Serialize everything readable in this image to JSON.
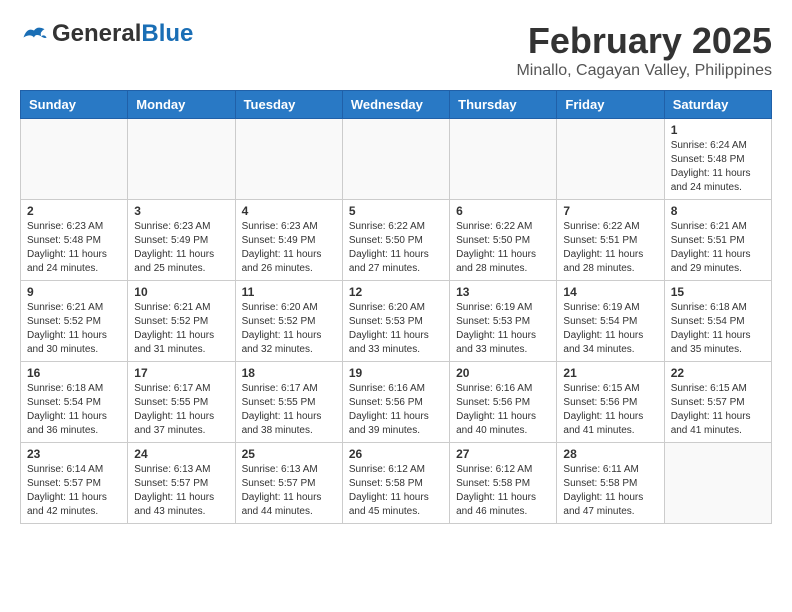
{
  "header": {
    "logo_general": "General",
    "logo_blue": "Blue",
    "title": "February 2025",
    "subtitle": "Minallo, Cagayan Valley, Philippines"
  },
  "weekdays": [
    "Sunday",
    "Monday",
    "Tuesday",
    "Wednesday",
    "Thursday",
    "Friday",
    "Saturday"
  ],
  "weeks": [
    [
      {
        "day": "",
        "info": ""
      },
      {
        "day": "",
        "info": ""
      },
      {
        "day": "",
        "info": ""
      },
      {
        "day": "",
        "info": ""
      },
      {
        "day": "",
        "info": ""
      },
      {
        "day": "",
        "info": ""
      },
      {
        "day": "1",
        "info": "Sunrise: 6:24 AM\nSunset: 5:48 PM\nDaylight: 11 hours\nand 24 minutes."
      }
    ],
    [
      {
        "day": "2",
        "info": "Sunrise: 6:23 AM\nSunset: 5:48 PM\nDaylight: 11 hours\nand 24 minutes."
      },
      {
        "day": "3",
        "info": "Sunrise: 6:23 AM\nSunset: 5:49 PM\nDaylight: 11 hours\nand 25 minutes."
      },
      {
        "day": "4",
        "info": "Sunrise: 6:23 AM\nSunset: 5:49 PM\nDaylight: 11 hours\nand 26 minutes."
      },
      {
        "day": "5",
        "info": "Sunrise: 6:22 AM\nSunset: 5:50 PM\nDaylight: 11 hours\nand 27 minutes."
      },
      {
        "day": "6",
        "info": "Sunrise: 6:22 AM\nSunset: 5:50 PM\nDaylight: 11 hours\nand 28 minutes."
      },
      {
        "day": "7",
        "info": "Sunrise: 6:22 AM\nSunset: 5:51 PM\nDaylight: 11 hours\nand 28 minutes."
      },
      {
        "day": "8",
        "info": "Sunrise: 6:21 AM\nSunset: 5:51 PM\nDaylight: 11 hours\nand 29 minutes."
      }
    ],
    [
      {
        "day": "9",
        "info": "Sunrise: 6:21 AM\nSunset: 5:52 PM\nDaylight: 11 hours\nand 30 minutes."
      },
      {
        "day": "10",
        "info": "Sunrise: 6:21 AM\nSunset: 5:52 PM\nDaylight: 11 hours\nand 31 minutes."
      },
      {
        "day": "11",
        "info": "Sunrise: 6:20 AM\nSunset: 5:52 PM\nDaylight: 11 hours\nand 32 minutes."
      },
      {
        "day": "12",
        "info": "Sunrise: 6:20 AM\nSunset: 5:53 PM\nDaylight: 11 hours\nand 33 minutes."
      },
      {
        "day": "13",
        "info": "Sunrise: 6:19 AM\nSunset: 5:53 PM\nDaylight: 11 hours\nand 33 minutes."
      },
      {
        "day": "14",
        "info": "Sunrise: 6:19 AM\nSunset: 5:54 PM\nDaylight: 11 hours\nand 34 minutes."
      },
      {
        "day": "15",
        "info": "Sunrise: 6:18 AM\nSunset: 5:54 PM\nDaylight: 11 hours\nand 35 minutes."
      }
    ],
    [
      {
        "day": "16",
        "info": "Sunrise: 6:18 AM\nSunset: 5:54 PM\nDaylight: 11 hours\nand 36 minutes."
      },
      {
        "day": "17",
        "info": "Sunrise: 6:17 AM\nSunset: 5:55 PM\nDaylight: 11 hours\nand 37 minutes."
      },
      {
        "day": "18",
        "info": "Sunrise: 6:17 AM\nSunset: 5:55 PM\nDaylight: 11 hours\nand 38 minutes."
      },
      {
        "day": "19",
        "info": "Sunrise: 6:16 AM\nSunset: 5:56 PM\nDaylight: 11 hours\nand 39 minutes."
      },
      {
        "day": "20",
        "info": "Sunrise: 6:16 AM\nSunset: 5:56 PM\nDaylight: 11 hours\nand 40 minutes."
      },
      {
        "day": "21",
        "info": "Sunrise: 6:15 AM\nSunset: 5:56 PM\nDaylight: 11 hours\nand 41 minutes."
      },
      {
        "day": "22",
        "info": "Sunrise: 6:15 AM\nSunset: 5:57 PM\nDaylight: 11 hours\nand 41 minutes."
      }
    ],
    [
      {
        "day": "23",
        "info": "Sunrise: 6:14 AM\nSunset: 5:57 PM\nDaylight: 11 hours\nand 42 minutes."
      },
      {
        "day": "24",
        "info": "Sunrise: 6:13 AM\nSunset: 5:57 PM\nDaylight: 11 hours\nand 43 minutes."
      },
      {
        "day": "25",
        "info": "Sunrise: 6:13 AM\nSunset: 5:57 PM\nDaylight: 11 hours\nand 44 minutes."
      },
      {
        "day": "26",
        "info": "Sunrise: 6:12 AM\nSunset: 5:58 PM\nDaylight: 11 hours\nand 45 minutes."
      },
      {
        "day": "27",
        "info": "Sunrise: 6:12 AM\nSunset: 5:58 PM\nDaylight: 11 hours\nand 46 minutes."
      },
      {
        "day": "28",
        "info": "Sunrise: 6:11 AM\nSunset: 5:58 PM\nDaylight: 11 hours\nand 47 minutes."
      },
      {
        "day": "",
        "info": ""
      }
    ]
  ]
}
